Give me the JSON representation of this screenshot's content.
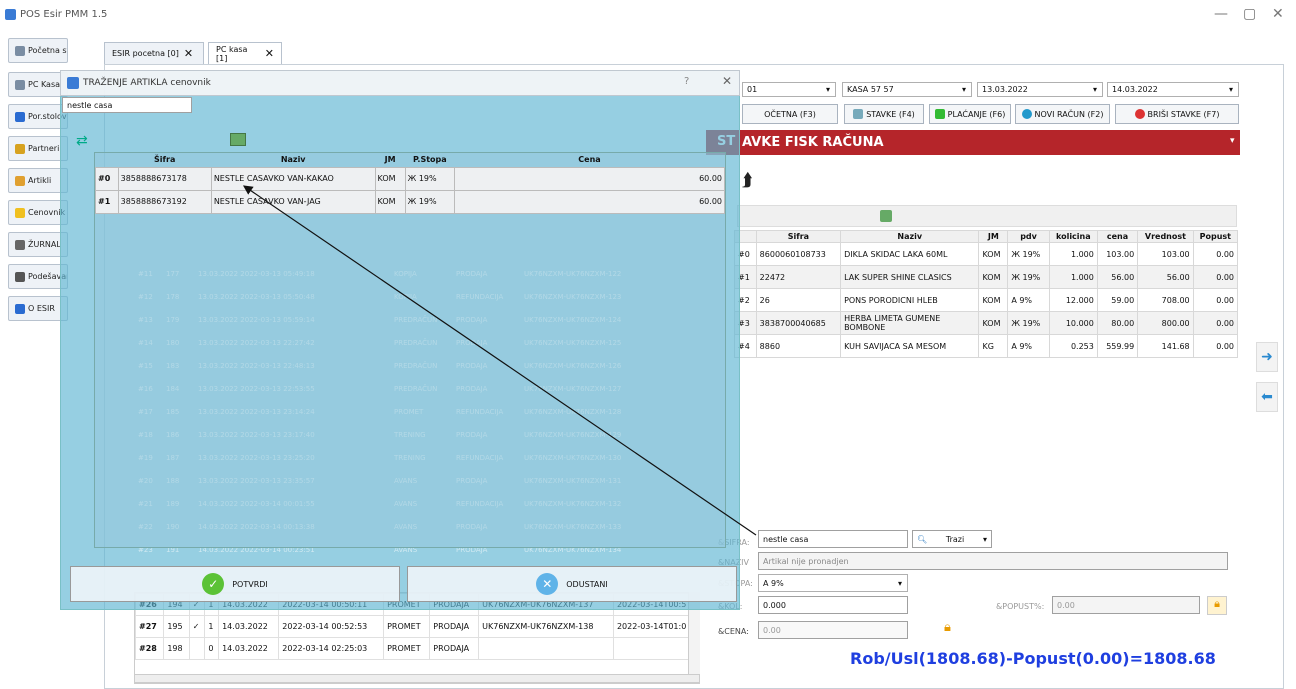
{
  "app": {
    "title": "POS Esir PMM 1.5"
  },
  "sidebar": {
    "items": [
      {
        "label": "Početna stranica",
        "color": "#7a8da3"
      },
      {
        "label": "PC Kasa",
        "color": "#7a8da3"
      },
      {
        "label": "Por.stolova",
        "color": "#2a6bd1"
      },
      {
        "label": "Partneri",
        "color": "#d7a21f"
      },
      {
        "label": "Artikli",
        "color": "#e0a030"
      },
      {
        "label": "Cenovnik",
        "color": "#f0c020"
      },
      {
        "label": "ŽURNAL",
        "color": "#666666"
      },
      {
        "label": "Podešavanja",
        "color": "#555555"
      },
      {
        "label": "O ESIR",
        "color": "#2a6bd1"
      }
    ]
  },
  "tabs": [
    {
      "label": "ESIR pocetna [0]",
      "close": "✕"
    },
    {
      "label": "PC kasa [1]",
      "close": "✕"
    }
  ],
  "filters": {
    "kasa_prefix": "01",
    "kasa": "KASA 57 57",
    "date_from": "13.03.2022",
    "date_to": "14.03.2022"
  },
  "toolbar": {
    "pocetna": "OČETNA (F3)",
    "stavke": "STAVKE (F4)",
    "placanje": "PLAĆANJE (F6)",
    "novi": "NOVI RAČUN (F2)",
    "brisi": "BRIŠI STAVKE (F7)"
  },
  "section_title": "AVKE FISK RAČUNA",
  "section_prefix": "ST",
  "items_table": {
    "headers": [
      "",
      "Sifra",
      "Naziv",
      "JM",
      "pdv",
      "kolicina",
      "cena",
      "Vrednost",
      "Popust"
    ],
    "rows": [
      [
        "#0",
        "8600060108733",
        "DIKLA SKIDAC LAKA 60ML",
        "KOM",
        "Ж 19%",
        "1.000",
        "103.00",
        "103.00",
        "0.00"
      ],
      [
        "#1",
        "22472",
        "LAK SUPER SHINE CLASICS",
        "KOM",
        "Ж 19%",
        "1.000",
        "56.00",
        "56.00",
        "0.00"
      ],
      [
        "#2",
        "26",
        "PONS PORODICNI HLEB",
        "KOM",
        "A 9%",
        "12.000",
        "59.00",
        "708.00",
        "0.00"
      ],
      [
        "#3",
        "3838700040685",
        "HERBA LIMETA GUMENE BOMBONE",
        "KOM",
        "Ж 19%",
        "10.000",
        "80.00",
        "800.00",
        "0.00"
      ],
      [
        "#4",
        "8860",
        "KUH SAVIJACA SA MESOM",
        "KG",
        "A 9%",
        "0.253",
        "559.99",
        "141.68",
        "0.00"
      ]
    ]
  },
  "form": {
    "sifra_label": "&SIFRA:",
    "sifra_value": "nestle casa",
    "trazi": "Trazi",
    "naziv_label": "&NAZIV",
    "naziv_value": "Artikal nije pronadjen",
    "stopa_label": "&STOPA:",
    "stopa_value": "A 9%",
    "kol_label": "&KOL:",
    "kol_value": "0.000",
    "popust_label": "&POPUST%:",
    "popust_value": "0.00",
    "cena_label": "&CENA:",
    "cena_value": "0.00"
  },
  "total": "Rob/Usl(1808.68)-Popust(0.00)=1808.68",
  "bottom_rows": [
    [
      "#26",
      "194",
      "✓",
      "1",
      "14.03.2022",
      "2022-03-14 00:50:11",
      "PROMET",
      "PRODAJA",
      "UK76NZXM-UK76NZXM-137",
      "2022-03-14T00:5"
    ],
    [
      "#27",
      "195",
      "✓",
      "1",
      "14.03.2022",
      "2022-03-14 00:52:53",
      "PROMET",
      "PRODAJA",
      "UK76NZXM-UK76NZXM-138",
      "2022-03-14T01:0"
    ],
    [
      "#28",
      "198",
      "",
      "0",
      "14.03.2022",
      "2022-03-14 02:25:03",
      "PROMET",
      "PRODAJA",
      "",
      ""
    ]
  ],
  "dialog": {
    "title": "TRAŽENJE ARTIKLA cenovnik",
    "help": "?",
    "close": "✕",
    "search_value": "nestle casa",
    "headers": [
      "",
      "Šifra",
      "Naziv",
      "JM",
      "P.Stopa",
      "Cena"
    ],
    "rows": [
      [
        "#0",
        "3858888673178",
        "NESTLE CASAVKO VAN-KAKAO",
        "KOM",
        "Ж 19%",
        "60.00"
      ],
      [
        "#1",
        "3858888673192",
        "NESTLE CASAVKO VAN-JAG",
        "KOM",
        "Ж 19%",
        "60.00"
      ]
    ],
    "confirm": "POTVRDI",
    "cancel": "ODUSTANI"
  },
  "ghost_rows": [
    [
      "#11",
      "177",
      "13.03.2022 2022-03-13 05:49:18",
      "KOPIJA",
      "PRODAJA",
      "UK76NZXM-UK76NZXM-122"
    ],
    [
      "#12",
      "178",
      "13.03.2022 2022-03-13 05:50:48",
      "KOPIJA",
      "REFUNDACIJA",
      "UK76NZXM-UK76NZXM-123"
    ],
    [
      "#13",
      "179",
      "13.03.2022 2022-03-13 05:59:14",
      "PREDRAČUN",
      "PRODAJA",
      "UK76NZXM-UK76NZXM-124"
    ],
    [
      "#14",
      "180",
      "13.03.2022 2022-03-13 22:27:42",
      "PREDRAČUN",
      "PRODAJA",
      "UK76NZXM-UK76NZXM-125"
    ],
    [
      "#15",
      "183",
      "13.03.2022 2022-03-13 22:48:13",
      "PREDRAČUN",
      "PRODAJA",
      "UK76NZXM-UK76NZXM-126"
    ],
    [
      "#16",
      "184",
      "13.03.2022 2022-03-13 22:53:55",
      "PREDRAČUN",
      "PRODAJA",
      "UK76NZXM-UK76NZXM-127"
    ],
    [
      "#17",
      "185",
      "13.03.2022 2022-03-13 23:14:24",
      "PROMET",
      "REFUNDACIJA",
      "UK76NZXM-UK76NZXM-128"
    ],
    [
      "#18",
      "186",
      "13.03.2022 2022-03-13 23:17:40",
      "TRENING",
      "PRODAJA",
      "UK76NZXM-UK76NZXM-129"
    ],
    [
      "#19",
      "187",
      "13.03.2022 2022-03-13 23:25:20",
      "TRENING",
      "REFUNDACIJA",
      "UK76NZXM-UK76NZXM-130"
    ],
    [
      "#20",
      "188",
      "13.03.2022 2022-03-13 23:35:57",
      "AVANS",
      "PRODAJA",
      "UK76NZXM-UK76NZXM-131"
    ],
    [
      "#21",
      "189",
      "14.03.2022 2022-03-14 00:01:55",
      "AVANS",
      "REFUNDACIJA",
      "UK76NZXM-UK76NZXM-132"
    ],
    [
      "#22",
      "190",
      "14.03.2022 2022-03-14 00:13:38",
      "AVANS",
      "PRODAJA",
      "UK76NZXM-UK76NZXM-133"
    ],
    [
      "#23",
      "191",
      "14.03.2022 2022-03-14 00:23:51",
      "AVANS",
      "PRODAJA",
      "UK76NZXM-UK76NZXM-134"
    ]
  ]
}
